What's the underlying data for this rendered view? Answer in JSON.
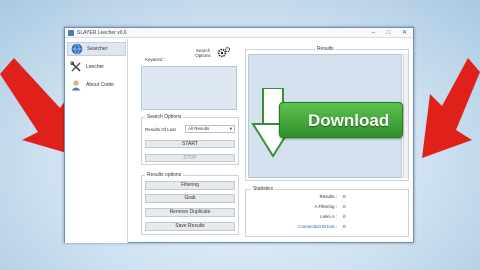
{
  "window": {
    "title": "SLAYER Leecher v0.6",
    "minimize": "–",
    "maximize": "□",
    "close": "✕"
  },
  "sidebar": {
    "items": [
      {
        "label": "Searcher",
        "icon": "globe-icon",
        "active": true
      },
      {
        "label": "Leecher",
        "icon": "tools-icon",
        "active": false
      },
      {
        "label": "About Coder",
        "icon": "user-icon",
        "active": false
      }
    ]
  },
  "search": {
    "keywords_label": "Keyword :",
    "options_label": "Search Options",
    "keywords_value": ""
  },
  "search_options": {
    "title": "Search Options",
    "results_label": "Results Of Last",
    "results_value": "All Results",
    "start_label": "START",
    "stop_label": "STOP"
  },
  "results_options": {
    "title": "Results options",
    "buttons": [
      "Filtering",
      "Grab",
      "Remove Duplicate",
      "Save Results"
    ]
  },
  "results": {
    "title": "Results",
    "overlay_text": "Download"
  },
  "statistics": {
    "title": "Statistics",
    "rows": [
      {
        "label": "Results :",
        "value": "0"
      },
      {
        "label": "A Filtering :",
        "value": "0"
      },
      {
        "label": "Links A :",
        "value": "0"
      },
      {
        "label": "Connection Errors :",
        "value": "0"
      }
    ]
  },
  "colors": {
    "arrow_red": "#e0201b",
    "download_green": "#3fa83a",
    "accent_blue": "#4a7ab8"
  }
}
